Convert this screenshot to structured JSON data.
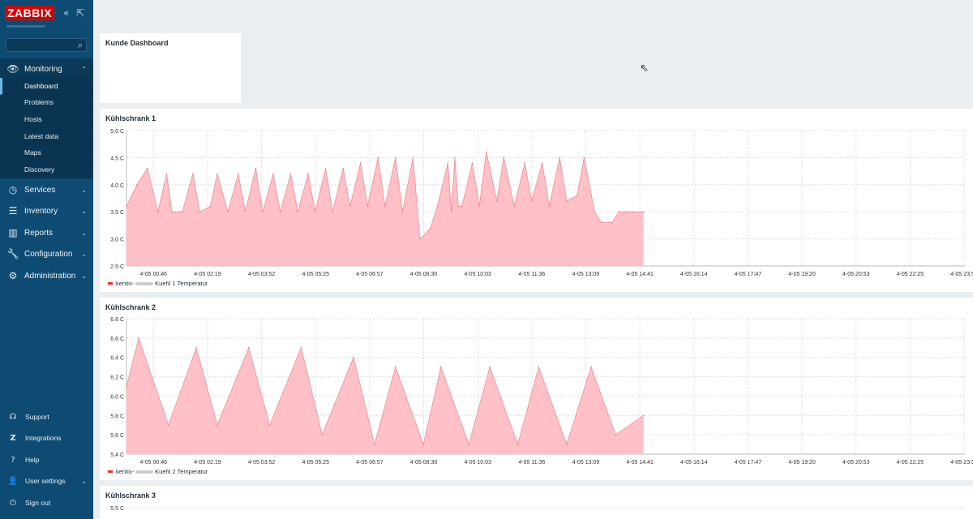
{
  "app": {
    "logo": "ZABBIX"
  },
  "sidebar": {
    "collapse_icon": "double-chevron-left-icon",
    "kiosk_icon": "kiosk-mode-icon",
    "search_placeholder": "",
    "menu": [
      {
        "label": "Monitoring",
        "icon": "eye-icon",
        "expanded": true
      },
      {
        "label": "Services",
        "icon": "clock-icon"
      },
      {
        "label": "Inventory",
        "icon": "list-icon"
      },
      {
        "label": "Reports",
        "icon": "bar-chart-icon"
      },
      {
        "label": "Configuration",
        "icon": "wrench-icon"
      },
      {
        "label": "Administration",
        "icon": "gear-icon"
      }
    ],
    "submenu": [
      "Dashboard",
      "Problems",
      "Hosts",
      "Latest data",
      "Maps",
      "Discovery"
    ],
    "bottom": [
      {
        "label": "Support",
        "icon": "headset-icon"
      },
      {
        "label": "Integrations",
        "icon": "zabbix-z-icon"
      },
      {
        "label": "Help",
        "icon": "question-icon"
      },
      {
        "label": "User settings",
        "icon": "user-icon"
      },
      {
        "label": "Sign out",
        "icon": "power-icon"
      }
    ]
  },
  "dashboard": {
    "title": "Kunde Dashboard"
  },
  "graphs": [
    {
      "title": "Kühlschrank 1",
      "legend_prefix": "kentix-",
      "legend_suffix": "Kuehl 1 Temperatur"
    },
    {
      "title": "Kühlschrank 2",
      "legend_prefix": "kentix-",
      "legend_suffix": "Kuehl 2 Temperatur"
    },
    {
      "title": "Kühlschrank 3"
    }
  ],
  "chart_data": [
    {
      "type": "area",
      "title": "Kühlschrank 1",
      "ylabel": "",
      "ylim": [
        2.5,
        5.0
      ],
      "yticks": [
        "2.5 C",
        "3.0 C",
        "3.5 C",
        "4.0 C",
        "4.5 C",
        "5.0 C"
      ],
      "xticks": [
        "4-05 00:46",
        "4-05 02:19",
        "4-05 03:52",
        "4-05 05:25",
        "4-05 06:57",
        "4-05 08:30",
        "4-05 10:03",
        "4-05 11:36",
        "4-05 13:09",
        "4-05 14:41",
        "4-05 16:14",
        "4-05 17:47",
        "4-05 19:20",
        "4-05 20:53",
        "4-05 22:25",
        "4-05 23:58"
      ],
      "x_hours": [
        0,
        0.3,
        0.6,
        0.9,
        1.15,
        1.3,
        1.6,
        1.9,
        2.1,
        2.4,
        2.6,
        2.9,
        3.2,
        3.4,
        3.7,
        3.9,
        4.2,
        4.4,
        4.7,
        4.9,
        5.2,
        5.4,
        5.7,
        5.9,
        6.2,
        6.4,
        6.7,
        6.9,
        7.2,
        7.4,
        7.7,
        7.9,
        8.2,
        8.4,
        8.7,
        8.9,
        9.2,
        9.3,
        9.4,
        9.5,
        9.6,
        9.9,
        10.1,
        10.3,
        10.6,
        10.8,
        11.1,
        11.4,
        11.6,
        11.9,
        12.1,
        12.4,
        12.6,
        12.9,
        13.1,
        13.4,
        13.6,
        13.9,
        14.1,
        14.3,
        14.5,
        14.8
      ],
      "grid": true,
      "series": [
        {
          "name": "kentix- Kuehl 1 Temperatur",
          "color": "#ffc0c7",
          "line_color": "#f48a96",
          "values": [
            3.6,
            4.0,
            4.3,
            3.5,
            4.2,
            3.5,
            3.5,
            4.2,
            3.5,
            3.6,
            4.2,
            3.5,
            4.2,
            3.5,
            4.3,
            3.5,
            4.2,
            3.5,
            4.2,
            3.5,
            4.2,
            3.5,
            4.3,
            3.5,
            4.3,
            3.6,
            4.4,
            3.6,
            4.5,
            3.6,
            4.5,
            3.5,
            4.5,
            3.0,
            3.2,
            3.6,
            4.4,
            3.5,
            4.5,
            3.6,
            3.6,
            4.4,
            3.6,
            4.6,
            3.7,
            4.5,
            3.6,
            4.4,
            3.7,
            4.4,
            3.6,
            4.5,
            3.7,
            3.8,
            4.5,
            3.5,
            3.3,
            3.3,
            3.5,
            3.5,
            3.5,
            3.5
          ]
        }
      ]
    },
    {
      "type": "area",
      "title": "Kühlschrank 2",
      "ylabel": "",
      "ylim": [
        5.4,
        6.8
      ],
      "yticks": [
        "5.4 C",
        "5.6 C",
        "5.8 C",
        "6.0 C",
        "6.2 C",
        "6.4 C",
        "6.6 C",
        "6.8 C"
      ],
      "xticks": [
        "4-05 00:46",
        "4-05 02:19",
        "4-05 03:52",
        "4-05 05:25",
        "4-05 06:57",
        "4-05 08:30",
        "4-05 10:03",
        "4-05 11:36",
        "4-05 13:09",
        "4-05 14:41",
        "4-05 16:14",
        "4-05 17:47",
        "4-05 19:20",
        "4-05 20:53",
        "4-05 22:25",
        "4-05 23:58"
      ],
      "x_hours": [
        0,
        0.35,
        1.2,
        2.0,
        2.6,
        3.5,
        4.1,
        5.0,
        5.6,
        6.5,
        7.1,
        7.7,
        8.5,
        9.0,
        9.8,
        10.4,
        11.2,
        11.8,
        12.6,
        13.3,
        14.0,
        14.8
      ],
      "grid": true,
      "series": [
        {
          "name": "kentix- Kuehl 2 Temperatur",
          "color": "#ffc0c7",
          "line_color": "#f48a96",
          "values": [
            6.1,
            6.6,
            5.7,
            6.5,
            5.7,
            6.5,
            5.7,
            6.5,
            5.6,
            6.4,
            5.5,
            6.3,
            5.5,
            6.3,
            5.5,
            6.3,
            5.5,
            6.3,
            5.5,
            6.3,
            5.6,
            5.8
          ]
        }
      ]
    },
    {
      "type": "area",
      "title": "Kühlschrank 3",
      "yticks": [
        "5.5 C"
      ]
    }
  ]
}
